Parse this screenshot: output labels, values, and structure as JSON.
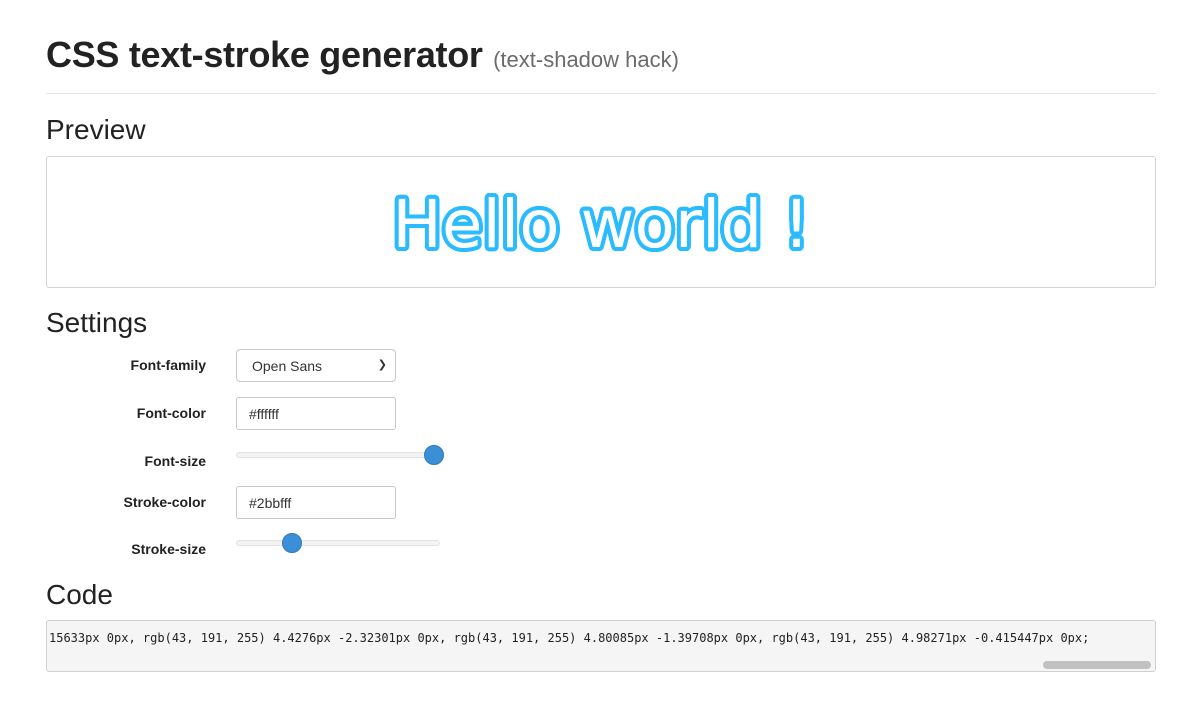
{
  "header": {
    "title": "CSS text-stroke generator",
    "subtitle": "(text-shadow hack)"
  },
  "preview": {
    "heading": "Preview",
    "sample_text": "Hello world !",
    "font_color": "#ffffff",
    "stroke_color": "#2bbbff"
  },
  "settings": {
    "heading": "Settings",
    "font_family": {
      "label": "Font-family",
      "value": "Open Sans"
    },
    "font_color": {
      "label": "Font-color",
      "value": "#ffffff"
    },
    "font_size": {
      "label": "Font-size",
      "level": 1.0
    },
    "stroke_color": {
      "label": "Stroke-color",
      "value": "#2bbfff"
    },
    "stroke_size": {
      "label": "Stroke-size",
      "level": 0.25
    }
  },
  "code": {
    "heading": "Code",
    "text": "15633px 0px, rgb(43, 191, 255) 4.4276px -2.32301px 0px, rgb(43, 191, 255) 4.80085px -1.39708px 0px, rgb(43, 191, 255) 4.98271px -0.415447px 0px;"
  },
  "icons": {
    "select_arrow": "chevron-down-icon"
  }
}
